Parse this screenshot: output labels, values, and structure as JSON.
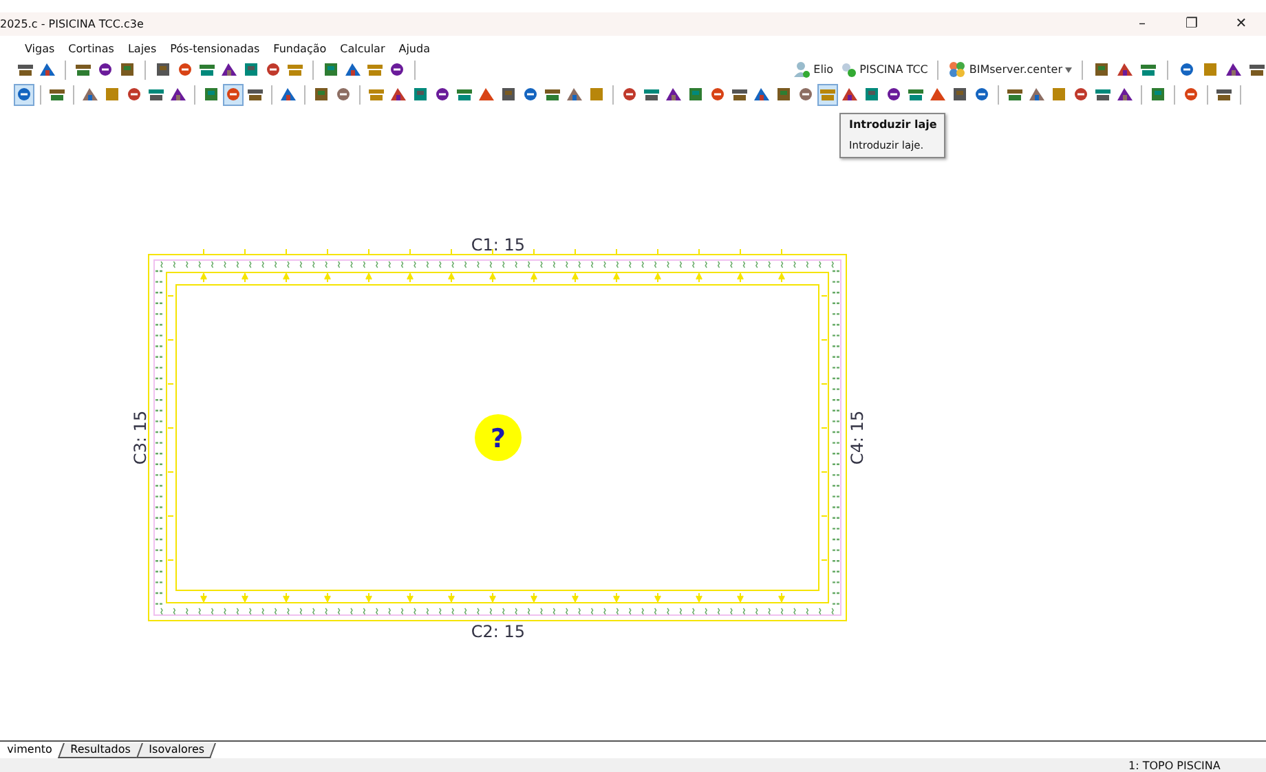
{
  "window": {
    "title": "2025.c - PISICINA TCC.c3e",
    "controls": [
      "–",
      "❐",
      "✕"
    ]
  },
  "menu": [
    {
      "label": "Vigas",
      "selected": false
    },
    {
      "label": "Cortinas",
      "selected": false
    },
    {
      "label": "Lajes",
      "selected": false
    },
    {
      "label": "Pós-tensionadas",
      "selected": false
    },
    {
      "label": "Fundação",
      "selected": false
    },
    {
      "label": "Calcular",
      "selected": false
    },
    {
      "label": "Ajuda",
      "selected": false
    }
  ],
  "account": {
    "user": "Elio",
    "project": "PISCINA TCC",
    "server": "BIMserver.center"
  },
  "toolbar_2": [
    {
      "kind": "button",
      "selected": true
    },
    {
      "kind": "separator"
    },
    {
      "kind": "button",
      "selected": false
    },
    {
      "kind": "separator"
    },
    {
      "kind": "button",
      "selected": false
    },
    {
      "kind": "button",
      "selected": false
    },
    {
      "kind": "button",
      "selected": false
    },
    {
      "kind": "button",
      "selected": false
    },
    {
      "kind": "button",
      "selected": false
    },
    {
      "kind": "separator"
    },
    {
      "kind": "button",
      "selected": false
    },
    {
      "kind": "button",
      "selected": true
    },
    {
      "kind": "button",
      "selected": false
    },
    {
      "kind": "separator"
    },
    {
      "kind": "button",
      "selected": false
    },
    {
      "kind": "separator"
    },
    {
      "kind": "button",
      "selected": false
    },
    {
      "kind": "button",
      "selected": false
    },
    {
      "kind": "separator"
    },
    {
      "kind": "button",
      "selected": false
    },
    {
      "kind": "button",
      "selected": false
    },
    {
      "kind": "button",
      "selected": false
    },
    {
      "kind": "button",
      "selected": false
    },
    {
      "kind": "button",
      "selected": false
    },
    {
      "kind": "button",
      "selected": false
    },
    {
      "kind": "button",
      "selected": false
    },
    {
      "kind": "button",
      "selected": false
    },
    {
      "kind": "button",
      "selected": false
    },
    {
      "kind": "button",
      "selected": false
    },
    {
      "kind": "button",
      "selected": false
    },
    {
      "kind": "separator"
    },
    {
      "kind": "button",
      "selected": false
    },
    {
      "kind": "button",
      "selected": false
    },
    {
      "kind": "button",
      "selected": false
    },
    {
      "kind": "button",
      "selected": false
    },
    {
      "kind": "button",
      "selected": false
    },
    {
      "kind": "button",
      "selected": false
    },
    {
      "kind": "button",
      "selected": false
    },
    {
      "kind": "button",
      "selected": false
    },
    {
      "kind": "button",
      "selected": false
    },
    {
      "kind": "button",
      "selected": true
    },
    {
      "kind": "button",
      "selected": false
    },
    {
      "kind": "button",
      "selected": false
    },
    {
      "kind": "button",
      "selected": false
    },
    {
      "kind": "button",
      "selected": false
    },
    {
      "kind": "button",
      "selected": false
    },
    {
      "kind": "button",
      "selected": false
    },
    {
      "kind": "button",
      "selected": false
    },
    {
      "kind": "separator"
    },
    {
      "kind": "button",
      "selected": false
    },
    {
      "kind": "button",
      "selected": false
    },
    {
      "kind": "button",
      "selected": false
    },
    {
      "kind": "button",
      "selected": false
    },
    {
      "kind": "button",
      "selected": false
    },
    {
      "kind": "button",
      "selected": false
    },
    {
      "kind": "separator"
    },
    {
      "kind": "button",
      "selected": false
    },
    {
      "kind": "separator"
    },
    {
      "kind": "button",
      "selected": false
    },
    {
      "kind": "separator"
    },
    {
      "kind": "button",
      "selected": false
    },
    {
      "kind": "separator"
    }
  ],
  "tooltip": {
    "title": "Introduzir laje",
    "text": "Introduzir laje."
  },
  "beams": [
    {
      "kind": "top",
      "label": "C1: 15"
    },
    {
      "kind": "bottom",
      "label": "C2: 15"
    },
    {
      "kind": "left",
      "label": "C3: 15"
    },
    {
      "kind": "right",
      "label": "C4: 15"
    }
  ],
  "marker": {
    "label": "?"
  },
  "tabs": [
    {
      "label": "vimento",
      "selected": true
    },
    {
      "label": "Resultados",
      "selected": false
    },
    {
      "label": "Isovalores",
      "selected": false
    }
  ],
  "status_bar": {
    "text": "1: TOPO PISCINA"
  }
}
